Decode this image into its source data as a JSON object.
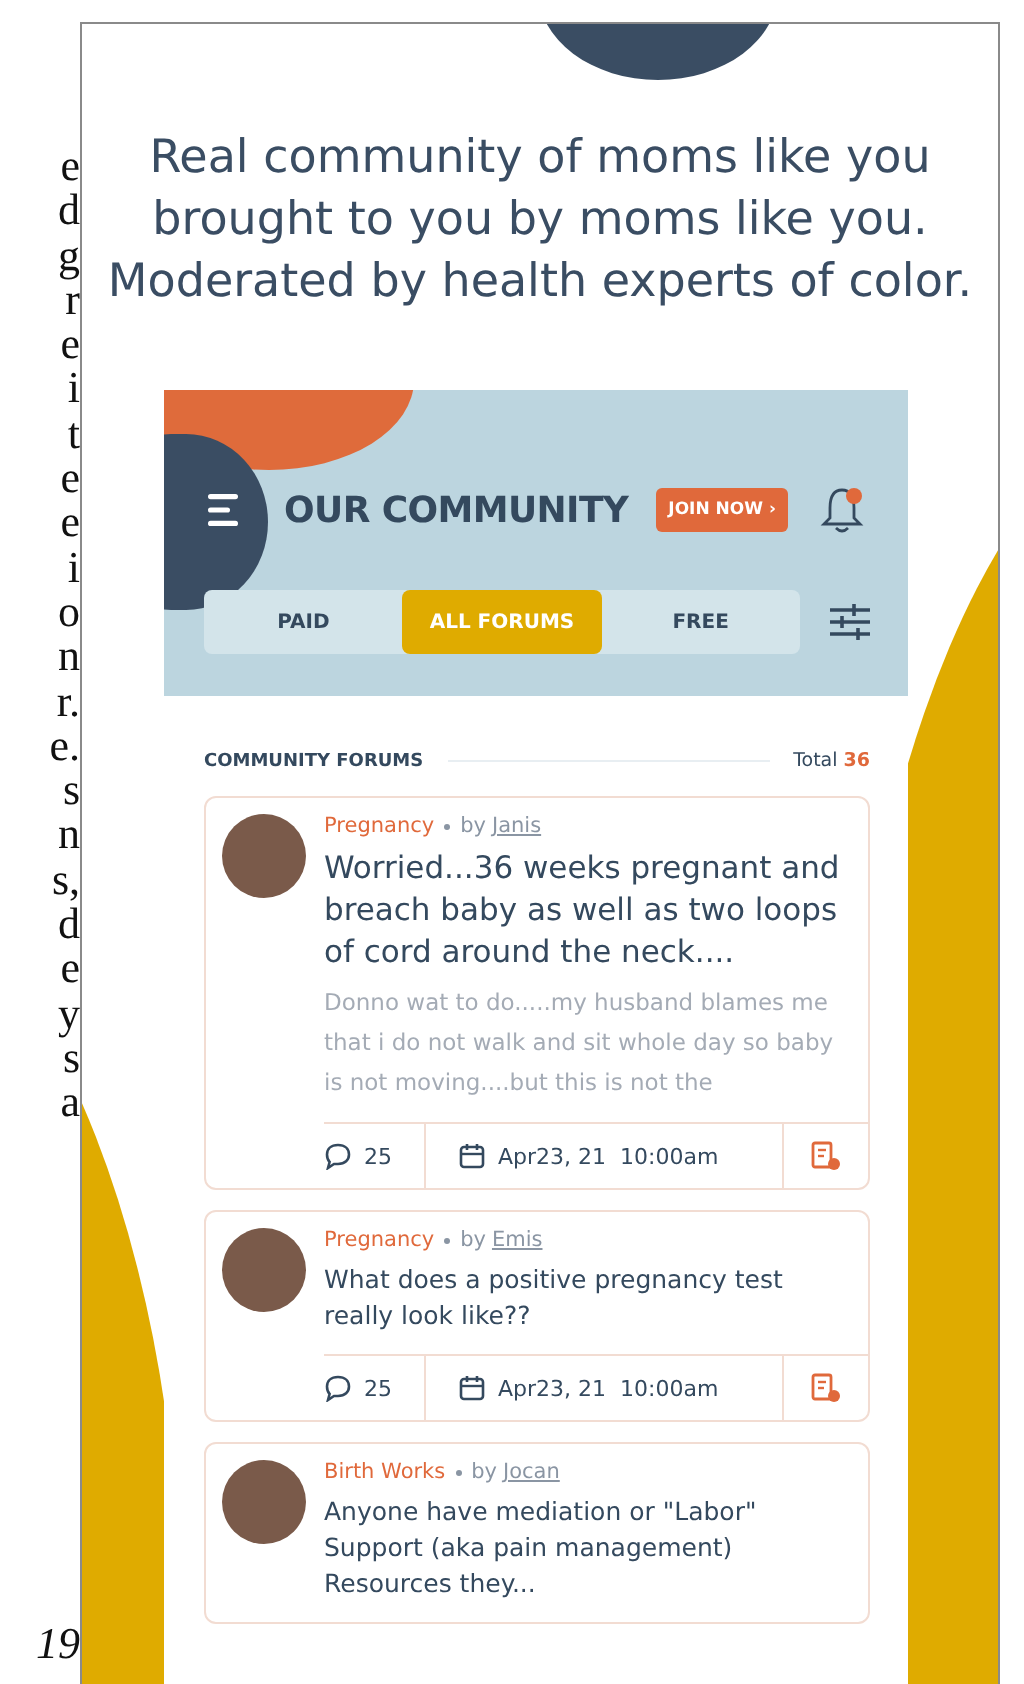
{
  "margin_text": {
    "lines": [
      "e",
      "d",
      "g",
      "r",
      "e",
      "i",
      "t",
      "e",
      "e",
      "i",
      "o",
      "n",
      "r.",
      "e.",
      "s",
      "n",
      "s,",
      "d",
      "e",
      "y",
      "s",
      "a"
    ],
    "page_number": "19"
  },
  "headline": "Real community of moms like you brought to you by moms like you. Moderated by health experts of color.",
  "app": {
    "title": "OUR COMMUNITY",
    "join_button": "JOIN NOW ›",
    "has_notification": true,
    "tabs": [
      {
        "label": "PAID",
        "selected": false
      },
      {
        "label": "ALL FORUMS",
        "selected": true
      },
      {
        "label": "FREE",
        "selected": false
      }
    ],
    "section_title": "COMMUNITY FORUMS",
    "total_label": "Total",
    "total_count": "36",
    "posts": [
      {
        "category": "Pregnancy",
        "by": "by",
        "author": "Janis",
        "featured": true,
        "title": "Worried...36 weeks pregnant and breach baby as well as two loops of cord around the neck....",
        "excerpt": "Donno wat to do.....my husband blames me that i do not walk and sit whole day so baby is not moving....but this is not the",
        "comments": "25",
        "date": "Apr23, 21  10:00am"
      },
      {
        "category": "Pregnancy",
        "by": "by",
        "author": "Emis",
        "featured": false,
        "title": "What does a positive pregnancy test really look like??",
        "comments": "25",
        "date": "Apr23, 21  10:00am"
      },
      {
        "category": "Birth Works",
        "by": "by",
        "author": "Jocan",
        "featured": false,
        "title": "Anyone have mediation or \"Labor\" Support (aka pain management) Resources they..."
      }
    ]
  }
}
